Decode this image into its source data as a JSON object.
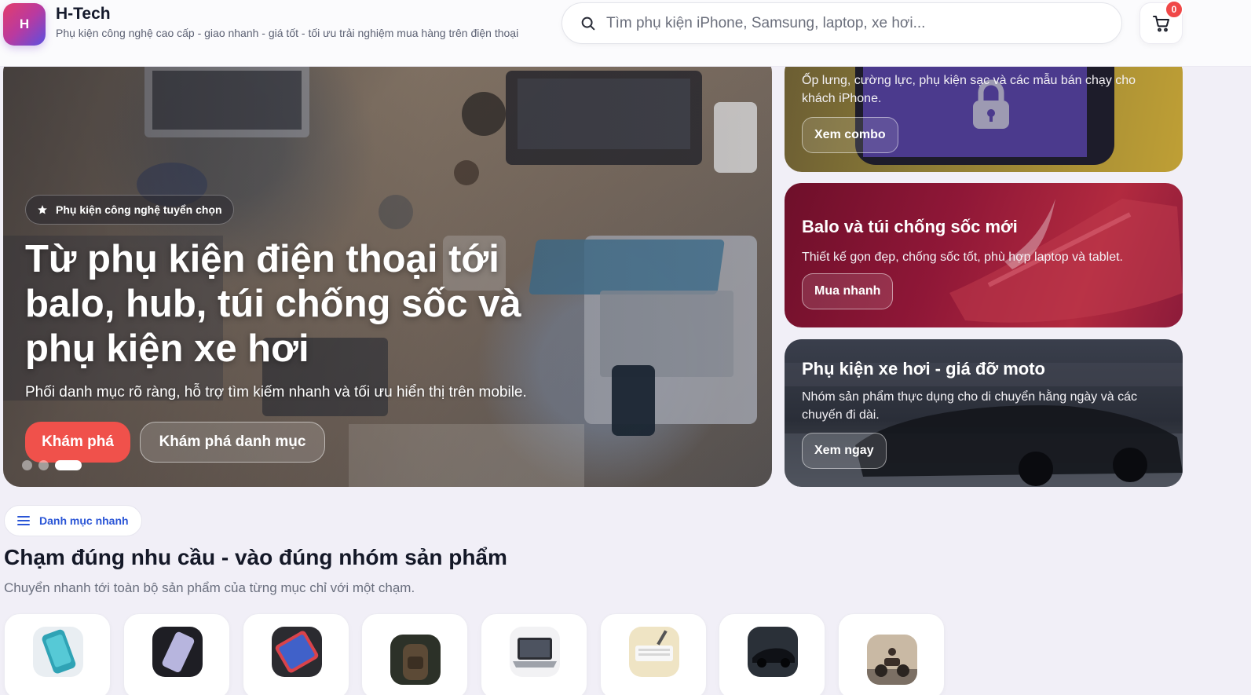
{
  "header": {
    "logo_letter": "H",
    "brand_name": "H-Tech",
    "tagline": "Phụ kiện công nghệ cao cấp - giao nhanh - giá tốt - tối ưu trải nghiệm mua hàng trên điện thoại",
    "search_placeholder": "Tìm phụ kiện iPhone, Samsung, laptop, xe hơi...",
    "cart_count": "0"
  },
  "hero": {
    "badge": "Phụ kiện công nghệ tuyển chọn",
    "title": "Từ phụ kiện điện thoại tới balo, hub, túi chống sốc và phụ kiện xe hơi",
    "subtitle": "Phối danh mục rõ ràng, hỗ trợ tìm kiếm nhanh và tối ưu hiển thị trên mobile.",
    "primary_button": "Khám phá",
    "secondary_button": "Khám phá danh mục",
    "slides_total": 3,
    "active_slide": 3
  },
  "promos": [
    {
      "title": "",
      "description": "Ốp lưng, cường lực, phụ kiện sạc và các mẫu bán chạy cho khách iPhone.",
      "button": "Xem combo"
    },
    {
      "title": "Balo và túi chống sốc mới",
      "description": "Thiết kế gọn đẹp, chống sốc tốt, phù hợp laptop và tablet.",
      "button": "Mua nhanh"
    },
    {
      "title": "Phụ kiện xe hơi - giá đỡ moto",
      "description": "Nhóm sản phẩm thực dụng cho di chuyển hằng ngày và các chuyến đi dài.",
      "button": "Xem ngay"
    }
  ],
  "quick_categories": {
    "chip_label": "Danh mục nhanh",
    "title": "Chạm đúng nhu cầu - vào đúng nhóm sản phẩm",
    "subtitle": "Chuyển nhanh tới toàn bộ sản phẩm của từng mục chỉ với một chạm."
  },
  "colors": {
    "accent": "#f0514b",
    "link_blue": "#2a55d6",
    "badge_red": "#f04848"
  }
}
